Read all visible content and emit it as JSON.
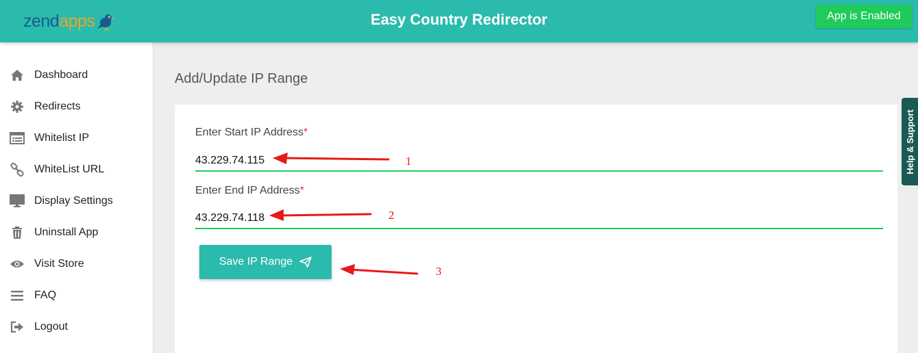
{
  "header": {
    "logo_part1": "zend",
    "logo_part2": "apps",
    "title": "Easy Country Redirector",
    "status_button": "App is Enabled"
  },
  "sidebar": {
    "items": [
      {
        "label": "Dashboard",
        "icon": "home-icon"
      },
      {
        "label": "Redirects",
        "icon": "gear-icon"
      },
      {
        "label": "Whitelist IP",
        "icon": "list-icon"
      },
      {
        "label": "WhiteList URL",
        "icon": "link-icon"
      },
      {
        "label": "Display Settings",
        "icon": "monitor-icon"
      },
      {
        "label": "Uninstall App",
        "icon": "trash-icon"
      },
      {
        "label": "Visit Store",
        "icon": "eye-icon"
      },
      {
        "label": "FAQ",
        "icon": "menu-icon"
      },
      {
        "label": "Logout",
        "icon": "logout-icon"
      }
    ]
  },
  "main": {
    "title": "Add/Update IP Range",
    "start_ip_label": "Enter Start IP Address",
    "start_ip_value": "43.229.74.115",
    "end_ip_label": "Enter End IP Address",
    "end_ip_value": "43.229.74.118",
    "required_marker": "*",
    "save_button": "Save IP Range"
  },
  "help_tab": "Help & Support",
  "annotations": {
    "numbers": [
      "1",
      "2",
      "3"
    ],
    "color": "#e81919"
  },
  "colors": {
    "primary": "#2bbbad",
    "enabled": "#1ecb5b",
    "help_tab": "#1a5a55"
  }
}
